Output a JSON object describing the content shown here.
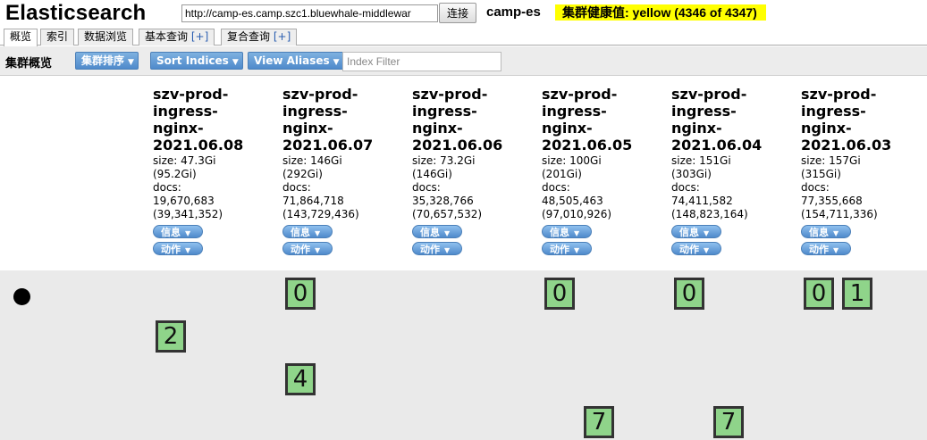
{
  "header": {
    "title": "Elasticsearch",
    "url_value": "http://camp-es.camp.szc1.bluewhale-middlewar",
    "connect_label": "连接",
    "cluster_name": "camp-es",
    "health": "集群健康值: yellow (4346 of 4347)",
    "health_color": "#ffff00"
  },
  "tabs": [
    {
      "label": "概览"
    },
    {
      "label": "索引"
    },
    {
      "label": "数据浏览"
    },
    {
      "label": "基本查询",
      "plus": "[+]"
    },
    {
      "label": "复合查询",
      "plus": "[+]"
    }
  ],
  "toolbar": {
    "label": "集群概览",
    "sort_cluster": "集群排序",
    "sort_indices": "Sort Indices",
    "view_aliases": "View Aliases",
    "filter_placeholder": "Index Filter"
  },
  "indices": [
    {
      "name": [
        "szv-prod-",
        "ingress-",
        "nginx-",
        "2021.06.08"
      ],
      "size": "size: 47.3Gi",
      "size_total": "(95.2Gi)",
      "docs_label": "docs:",
      "docs": "19,670,683",
      "docs_total": "(39,341,352)",
      "info": "信息",
      "action": "动作"
    },
    {
      "name": [
        "szv-prod-",
        "ingress-",
        "nginx-",
        "2021.06.07"
      ],
      "size": "size: 146Gi",
      "size_total": "(292Gi)",
      "docs_label": "docs:",
      "docs": "71,864,718",
      "docs_total": "(143,729,436)",
      "info": "信息",
      "action": "动作"
    },
    {
      "name": [
        "szv-prod-",
        "ingress-",
        "nginx-",
        "2021.06.06"
      ],
      "size": "size: 73.2Gi",
      "size_total": "(146Gi)",
      "docs_label": "docs:",
      "docs": "35,328,766",
      "docs_total": "(70,657,532)",
      "info": "信息",
      "action": "动作"
    },
    {
      "name": [
        "szv-prod-",
        "ingress-",
        "nginx-",
        "2021.06.05"
      ],
      "size": "size: 100Gi",
      "size_total": "(201Gi)",
      "docs_label": "docs:",
      "docs": "48,505,463",
      "docs_total": "(97,010,926)",
      "info": "信息",
      "action": "动作"
    },
    {
      "name": [
        "szv-prod-",
        "ingress-",
        "nginx-",
        "2021.06.04"
      ],
      "size": "size: 151Gi",
      "size_total": "(303Gi)",
      "docs_label": "docs:",
      "docs": "74,411,582",
      "docs_total": "(148,823,164)",
      "info": "信息",
      "action": "动作"
    },
    {
      "name": [
        "szv-prod-",
        "ingress-",
        "nginx-",
        "2021.06.03"
      ],
      "size": "size: 157Gi",
      "size_total": "(315Gi)",
      "docs_label": "docs:",
      "docs": "77,355,668",
      "docs_total": "(154,711,336)",
      "info": "信息",
      "action": "动作"
    }
  ],
  "shards": [
    {
      "label": "0"
    },
    {
      "label": "0"
    },
    {
      "label": "0"
    },
    {
      "label": "0"
    },
    {
      "label": "1"
    },
    {
      "label": "2"
    },
    {
      "label": "4"
    },
    {
      "label": "7"
    },
    {
      "label": "7"
    }
  ],
  "colors": {
    "shard_green": "#8fd48a",
    "button_blue": "#4f8acb"
  }
}
